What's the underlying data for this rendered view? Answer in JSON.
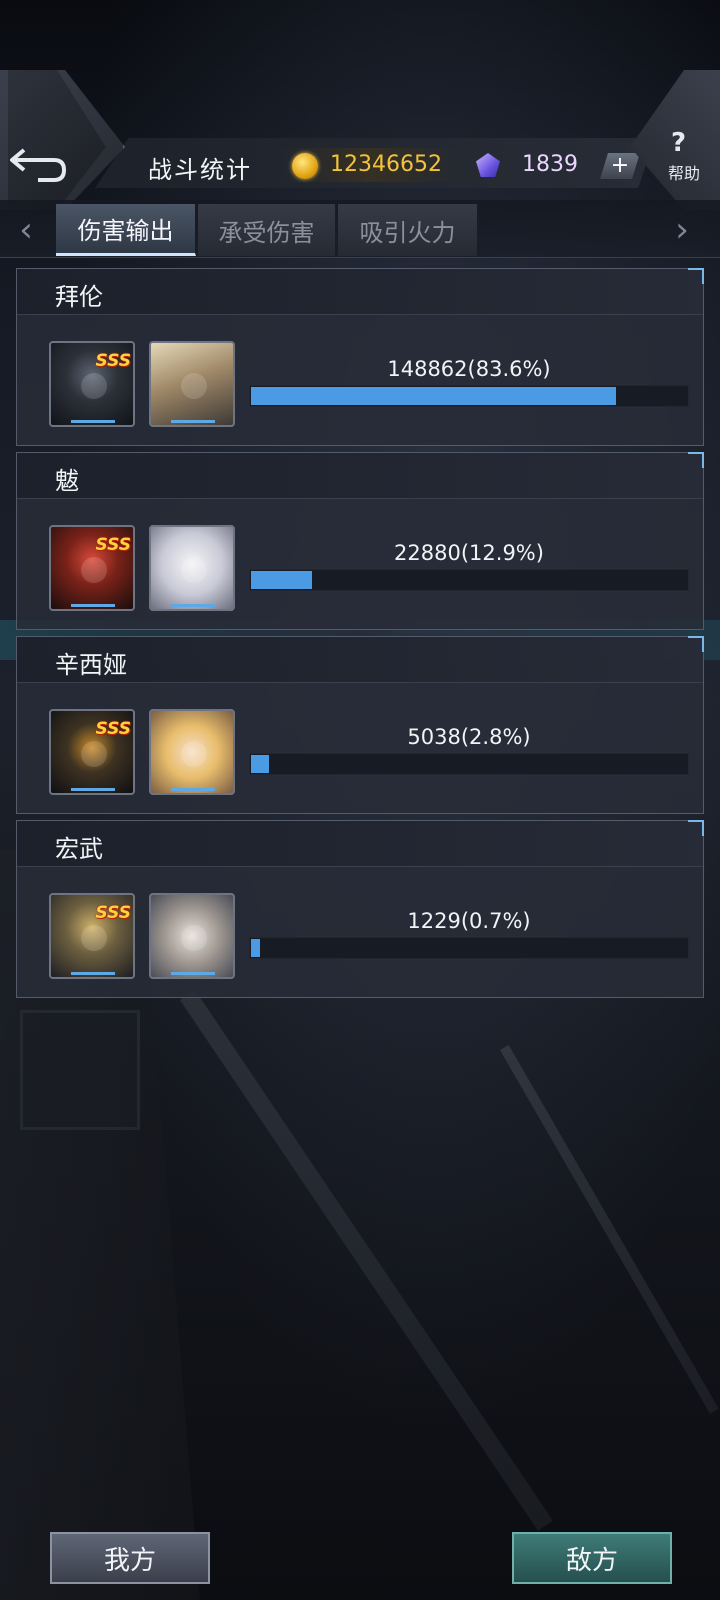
{
  "header": {
    "title": "战斗统计",
    "coins": "12346652",
    "gems": "1839",
    "plus_label": "+",
    "help_label": "帮助",
    "help_symbol": "?"
  },
  "tabs": [
    {
      "label": "伤害输出",
      "active": true
    },
    {
      "label": "承受伤害",
      "active": false
    },
    {
      "label": "吸引火力",
      "active": false
    }
  ],
  "stats": [
    {
      "name": "拜伦",
      "value_text": "148862(83.6%)",
      "percent": 83.6,
      "rank": "SSS"
    },
    {
      "name": "魃",
      "value_text": "22880(12.9%)",
      "percent": 12.9,
      "rank": "SSS"
    },
    {
      "name": "辛西娅",
      "value_text": "5038(2.8%)",
      "percent": 2.8,
      "rank": "SSS"
    },
    {
      "name": "宏武",
      "value_text": "1229(0.7%)",
      "percent": 0.7,
      "rank": "SSS"
    }
  ],
  "footer": {
    "ours_label": "我方",
    "enemy_label": "敌方"
  },
  "colors": {
    "bar_fill": "#4a9be3",
    "coin": "#f2c33b",
    "gem_text": "#ecd6ff"
  }
}
